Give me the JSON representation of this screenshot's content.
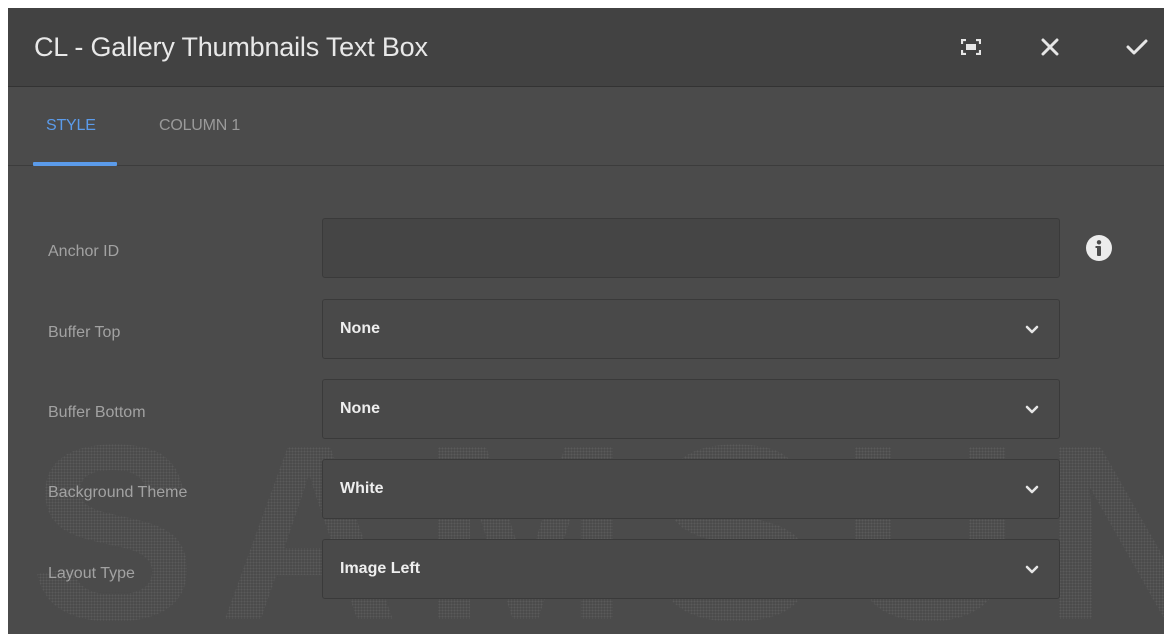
{
  "dialog": {
    "title": "CL - Gallery Thumbnails Text Box",
    "actions": [
      "fullscreen-icon",
      "close-icon",
      "check-icon"
    ]
  },
  "tabs": [
    {
      "label": "STYLE",
      "active": true
    },
    {
      "label": "COLUMN 1",
      "active": false
    }
  ],
  "form": {
    "anchor_id": {
      "label": "Anchor ID",
      "value": "",
      "info_icon": "info-icon"
    },
    "buffer_top": {
      "label": "Buffer Top",
      "value": "None"
    },
    "buffer_bottom": {
      "label": "Buffer Bottom",
      "value": "None"
    },
    "background_theme": {
      "label": "Background Theme",
      "value": "White"
    },
    "layout_type": {
      "label": "Layout Type",
      "value": "Image Left"
    }
  },
  "watermark": {
    "text": "SAMSUNG"
  },
  "colors": {
    "accent": "#5b9bea",
    "titlebar": "#424242",
    "panel": "#4b4b4b",
    "text": "#e8e8e8"
  }
}
